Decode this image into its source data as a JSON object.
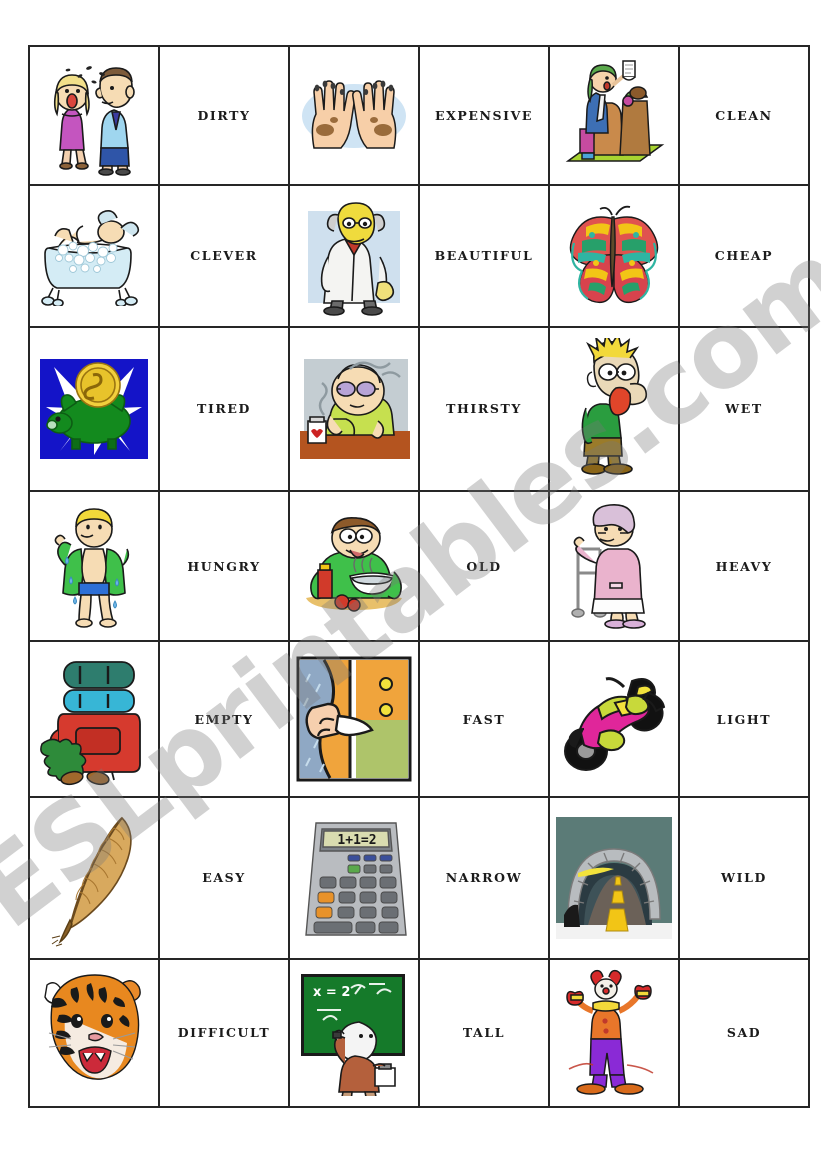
{
  "document": {
    "type": "vocabulary-matching-worksheet",
    "watermark": "ESLprintables.com",
    "grid": {
      "columns": 6,
      "rows": 7
    }
  },
  "rows": [
    {
      "cells": [
        {
          "kind": "picture",
          "art": "smelly-couple",
          "alt": "Woman and man with flies, bad smell"
        },
        {
          "kind": "word",
          "label": "DIRTY"
        },
        {
          "kind": "picture",
          "art": "dirty-hands",
          "alt": "Two dirty hands"
        },
        {
          "kind": "word",
          "label": "EXPENSIVE"
        },
        {
          "kind": "picture",
          "art": "shopper-receipt",
          "alt": "Shopper with grocery bags and long receipt"
        },
        {
          "kind": "word",
          "label": "CLEAN"
        }
      ]
    },
    {
      "cells": [
        {
          "kind": "picture",
          "art": "bathtub-bubbles",
          "alt": "Person relaxing in a bubble bath"
        },
        {
          "kind": "word",
          "label": "CLEVER"
        },
        {
          "kind": "picture",
          "art": "scientist",
          "alt": "Scientist in white lab coat"
        },
        {
          "kind": "word",
          "label": "BEAUTIFUL"
        },
        {
          "kind": "picture",
          "art": "butterfly",
          "alt": "Colourful butterfly"
        },
        {
          "kind": "word",
          "label": "CHEAP"
        }
      ]
    },
    {
      "cells": [
        {
          "kind": "picture",
          "art": "piggy-bank-coin",
          "alt": "Green piggy bank with gold coin on blue burst"
        },
        {
          "kind": "word",
          "label": "TIRED"
        },
        {
          "kind": "picture",
          "art": "sick-person-table",
          "alt": "Exhausted person resting head on table beside medicine"
        },
        {
          "kind": "word",
          "label": "THIRSTY"
        },
        {
          "kind": "picture",
          "art": "thirsty-man-tongue",
          "alt": "Man with tongue hanging out, thirsty"
        },
        {
          "kind": "word",
          "label": "WET"
        }
      ]
    },
    {
      "cells": [
        {
          "kind": "picture",
          "art": "cold-child",
          "alt": "Child shivering, wet and cold"
        },
        {
          "kind": "word",
          "label": "HUNGRY"
        },
        {
          "kind": "picture",
          "art": "man-eating",
          "alt": "Man eating a big plate of food with ketchup"
        },
        {
          "kind": "word",
          "label": "OLD"
        },
        {
          "kind": "picture",
          "art": "old-lady-walker",
          "alt": "Old lady with a walking frame"
        },
        {
          "kind": "word",
          "label": "HEAVY"
        }
      ]
    },
    {
      "cells": [
        {
          "kind": "picture",
          "art": "backpack",
          "alt": "Large loaded hiking backpack with boots"
        },
        {
          "kind": "word",
          "label": "EMPTY"
        },
        {
          "kind": "picture",
          "art": "empty-pocket",
          "alt": "Hand pulling out an empty trouser pocket"
        },
        {
          "kind": "word",
          "label": "FAST"
        },
        {
          "kind": "picture",
          "art": "motorbike",
          "alt": "Pink racing motorbike leaning into a turn"
        },
        {
          "kind": "word",
          "label": "LIGHT"
        }
      ]
    },
    {
      "cells": [
        {
          "kind": "picture",
          "art": "feather",
          "alt": "Brown quill feather"
        },
        {
          "kind": "word",
          "label": "EASY"
        },
        {
          "kind": "picture",
          "art": "calculator",
          "alt": "Calculator showing 1+1=2"
        },
        {
          "kind": "word",
          "label": "NARROW"
        },
        {
          "kind": "picture",
          "art": "tunnel",
          "alt": "Stone tunnel with a narrow road"
        },
        {
          "kind": "word",
          "label": "WILD"
        }
      ]
    },
    {
      "cells": [
        {
          "kind": "picture",
          "art": "tiger",
          "alt": "Roaring tiger head"
        },
        {
          "kind": "word",
          "label": "DIFFICULT"
        },
        {
          "kind": "picture",
          "art": "blackboard-maths",
          "alt": "Person writing a maths equation on a green blackboard"
        },
        {
          "kind": "word",
          "label": "TALL"
        },
        {
          "kind": "picture",
          "art": "clown",
          "alt": "Tall clown with arms raised"
        },
        {
          "kind": "word",
          "label": "SAD"
        }
      ]
    }
  ],
  "calculator": {
    "display": "1+1=2"
  },
  "blackboard": {
    "equation": "x = 2"
  },
  "colors": {
    "border": "#262626",
    "text": "#1b1b1b",
    "watermark": "rgba(120,120,120,0.34)"
  }
}
